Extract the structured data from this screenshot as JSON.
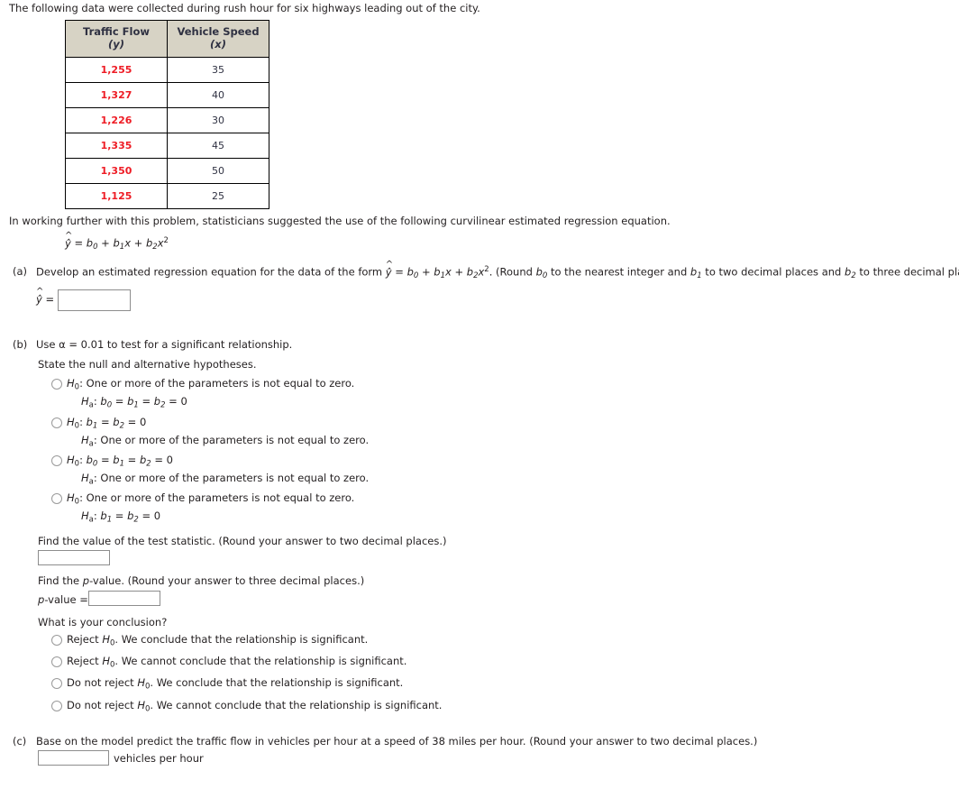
{
  "intro": {
    "text": "The following data were collected during rush hour for six highways leading out of the city."
  },
  "table": {
    "headers": [
      {
        "title": "Traffic Flow",
        "symbol": "(y)"
      },
      {
        "title": "Vehicle Speed",
        "symbol": "(x)"
      }
    ],
    "rows": [
      {
        "flow": "1,255",
        "speed": "35"
      },
      {
        "flow": "1,327",
        "speed": "40"
      },
      {
        "flow": "1,226",
        "speed": "30"
      },
      {
        "flow": "1,335",
        "speed": "45"
      },
      {
        "flow": "1,350",
        "speed": "50"
      },
      {
        "flow": "1,125",
        "speed": "25"
      }
    ],
    "flow_color": "#ee1c25",
    "header_bg": "#d7d3c5"
  },
  "lead_in": {
    "text": "In working further with this problem, statisticians suggested the use of the following curvilinear estimated regression equation."
  },
  "equation": {
    "display": "ŷ = b0 + b1x + b2x2"
  },
  "part_a": {
    "label": "(a)",
    "prompt_start": "Develop an estimated regression equation for the data of the form ",
    "prompt_end": ". (Round ",
    "round_mid1": " to the nearest integer and ",
    "round_mid2": " to two decimal places and ",
    "round_end": " to three decimal places.)",
    "answer_prefix": "ŷ =",
    "answer_value": "",
    "answer_placeholder": ""
  },
  "part_b": {
    "label": "(b)",
    "prompt": "Use α = 0.01 to test for a significant relationship.",
    "hypotheses_prompt": "State the null and alternative hypotheses.",
    "hypotheses_options": [
      {
        "null_label": "H0:",
        "null_text": "One or more of the parameters is not equal to zero.",
        "alt_label": "Ha:",
        "alt_text": "b0 = b1 = b2 = 0"
      },
      {
        "null_label": "H0:",
        "null_text": "b1 = b2 = 0",
        "alt_label": "Ha:",
        "alt_text": "One or more of the parameters is not equal to zero."
      },
      {
        "null_label": "H0:",
        "null_text": "b0 = b1 = b2 = 0",
        "alt_label": "Ha:",
        "alt_text": "One or more of the parameters is not equal to zero."
      },
      {
        "null_label": "H0:",
        "null_text": "One or more of the parameters is not equal to zero.",
        "alt_label": "Ha:",
        "alt_text": "b1 = b2 = 0"
      }
    ],
    "test_statistic_prompt": "Find the value of the test statistic. (Round your answer to two decimal places.)",
    "test_statistic_value": "",
    "pvalue_prompt": "Find the p-value. (Round your answer to three decimal places.)",
    "pvalue_label": "p-value =",
    "pvalue_value": "",
    "conclusion_prompt": "What is your conclusion?",
    "conclusion_options": [
      "Reject H0. We conclude that the relationship is significant.",
      "Reject H0. We cannot conclude that the relationship is significant.",
      "Do not reject H0. We conclude that the relationship is significant.",
      "Do not reject H0. We cannot conclude that the relationship is significant."
    ]
  },
  "part_c": {
    "label": "(c)",
    "prompt": "Base on the model predict the traffic flow in vehicles per hour at a speed of 38 miles per hour. (Round your answer to two decimal places.)",
    "answer_value": "",
    "units": "vehicles per hour"
  }
}
